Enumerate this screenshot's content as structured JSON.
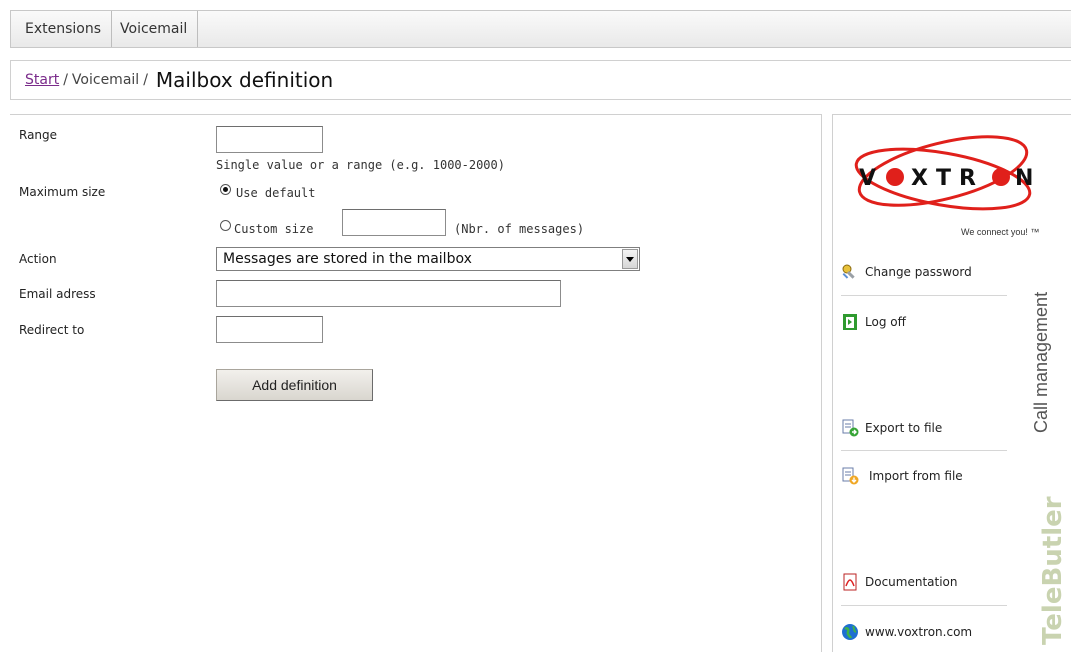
{
  "tabs": [
    "Extensions",
    "Voicemail"
  ],
  "breadcrumb": {
    "start": "Start",
    "sep": "/",
    "section": "Voicemail",
    "title": "Mailbox definition"
  },
  "form": {
    "range_label": "Range",
    "range_value": "",
    "range_hint": "Single value or a range (e.g. 1000-2000)",
    "maxsize_label": "Maximum size",
    "use_default_label": "Use default",
    "custom_size_label": "Custom size",
    "custom_size_value": "",
    "custom_size_hint": "(Nbr. of messages)",
    "action_label": "Action",
    "action_selected": "Messages are stored in the mailbox",
    "email_label": "Email adress",
    "email_value": "",
    "redirect_label": "Redirect to",
    "redirect_value": "",
    "add_button": "Add definition"
  },
  "logo": {
    "name_part1": "V",
    "name_part2": "XTR",
    "name_part3": "N",
    "tagline": "We connect you! ™"
  },
  "sidebar": {
    "items": [
      {
        "label": "Change password",
        "icon": "key-icon"
      },
      {
        "label": "Log off",
        "icon": "exit-door-icon"
      },
      {
        "label": "Export to file",
        "icon": "export-file-icon"
      },
      {
        "label": "Import from file",
        "icon": "import-file-icon"
      },
      {
        "label": "Documentation",
        "icon": "pdf-icon"
      },
      {
        "label": "www.voxtron.com",
        "icon": "globe-icon"
      }
    ],
    "brand_main": "TeleButler",
    "brand_sub": "Call management"
  },
  "colors": {
    "link": "#7a2b8a",
    "logo_red": "#e0201b",
    "brand_green": "#c9d3b0"
  }
}
